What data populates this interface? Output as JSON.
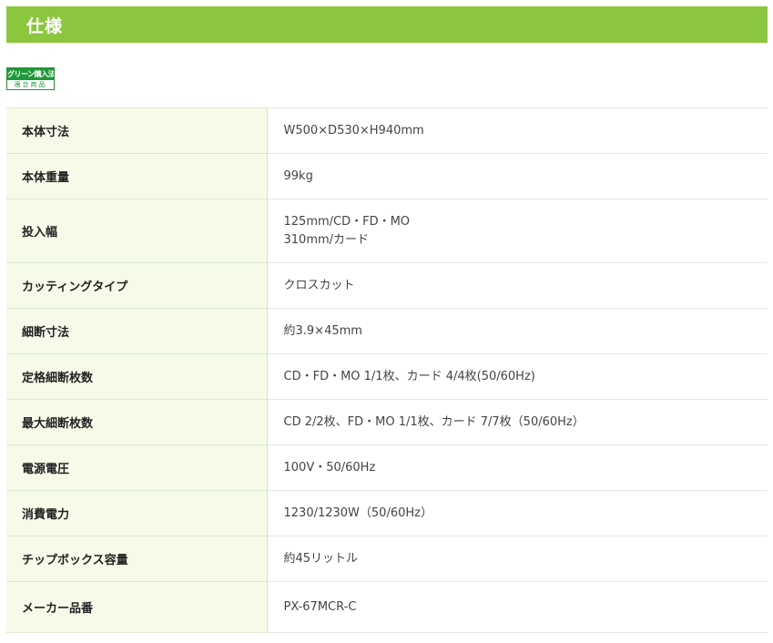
{
  "heading": "仕様",
  "badge": {
    "line1": "グリーン購入法",
    "line2": "適合商品"
  },
  "colors": {
    "accent": "#8cc63f",
    "label_bg": "#f5fbe8",
    "badge_green": "#1e9a3a"
  },
  "specs": [
    {
      "label": "本体寸法",
      "value": [
        "W500×D530×H940mm"
      ]
    },
    {
      "label": "本体重量",
      "value": [
        "99kg"
      ]
    },
    {
      "label": "投入幅",
      "value": [
        "125mm/CD・FD・MO",
        "310mm/カード"
      ]
    },
    {
      "label": "カッティングタイプ",
      "value": [
        "クロスカット"
      ]
    },
    {
      "label": "細断寸法",
      "value": [
        "約3.9×45mm"
      ]
    },
    {
      "label": "定格細断枚数",
      "value": [
        "CD・FD・MO 1/1枚、カード 4/4枚(50/60Hz)"
      ]
    },
    {
      "label": "最大細断枚数",
      "value": [
        "CD 2/2枚、FD・MO 1/1枚、カード 7/7枚（50/60Hz）"
      ]
    },
    {
      "label": "電源電圧",
      "value": [
        "100V・50/60Hz"
      ]
    },
    {
      "label": "消費電力",
      "value": [
        "1230/1230W（50/60Hz）"
      ]
    },
    {
      "label": "チップボックス容量",
      "value": [
        "約45リットル"
      ]
    },
    {
      "label": "メーカー品番",
      "value": [
        "PX-67MCR-C"
      ]
    }
  ]
}
